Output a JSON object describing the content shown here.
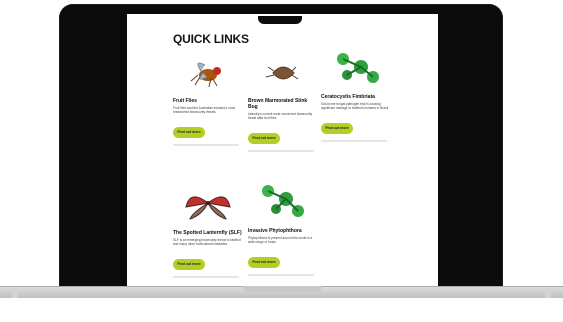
{
  "page": {
    "title": "QUICK LINKS"
  },
  "cards": [
    {
      "name": "Fruit Flies",
      "desc": "Fruit flies cost the Australian industry’s most researched biosecurity threats",
      "button": "Find out more",
      "icon": "fruit-fly-icon"
    },
    {
      "name": "Brown Marmorated Stink Bug",
      "desc": "Industry’s current most concerned biosecurity threat after fruit flies.",
      "button": "Find out more",
      "icon": "stink-bug-icon"
    },
    {
      "name": "Ceratocystis Fimbriata",
      "desc": "Soil-borne fungal pathogen that is causing significant damage to kiwifruit orchards in Brazil.",
      "button": "Find out more",
      "icon": "ceratocystis-icon"
    },
    {
      "name": "The Spotted Lanternfly (SLF)",
      "desc": "SLF is an emerging biosecurity threat to kiwifruit and many other horticultural industries.",
      "button": "Find out more",
      "icon": "spotted-lanternfly-icon"
    },
    {
      "name": "Invasive Phytophthora",
      "desc": "Phytophthora is present around the world in a wide range of hosts.",
      "button": "Find out more",
      "icon": "phytophthora-icon"
    }
  ],
  "colors": {
    "accent": "#b3cf27",
    "frame": "#0b0b0b",
    "divider": "#e6e6e6"
  }
}
